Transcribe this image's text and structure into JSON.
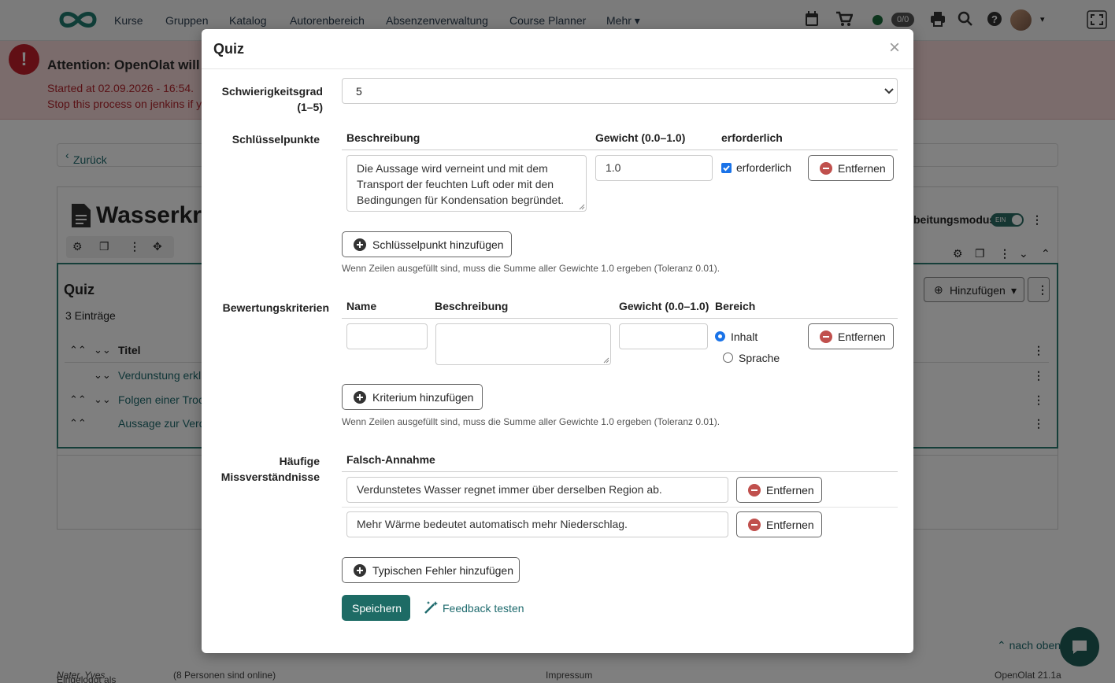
{
  "nav": {
    "items": [
      "Kurse",
      "Gruppen",
      "Katalog",
      "Autorenbereich",
      "Absenzenverwaltung",
      "Course Planner",
      "Mehr"
    ],
    "counter": "0/0"
  },
  "alert": {
    "title": "Attention: OpenOlat will s",
    "line1": "Started at 02.09.2026 - 16:54.",
    "line2": "Stop this process on jenkins if y"
  },
  "page": {
    "back": "Zurück",
    "title": "Wasserkre",
    "mode_label": "beitungsmodus",
    "toggle": "EIN",
    "quiz_title": "Quiz",
    "entries": "3 Einträge",
    "col_title": "Titel",
    "rows": [
      "Verdunstung erkl",
      "Folgen einer Troc",
      "Aussage zur Verd"
    ],
    "add_button": "Hinzufügen",
    "nach_oben": "nach oben"
  },
  "footer": {
    "logged_prefix": "Eingeloggt als",
    "user": "Nater, Yves",
    "online": "(8 Personen sind online)",
    "impressum": "Impressum",
    "version": "OpenOlat 21.1a"
  },
  "modal": {
    "title": "Quiz",
    "close": "×",
    "difficulty": {
      "label_line1": "Schwierigkeitsgrad",
      "label_line2": "(1–5)",
      "value": "5"
    },
    "keypoints": {
      "label": "Schlüsselpunkte",
      "col_desc": "Beschreibung",
      "col_weight": "Gewicht (0.0–1.0)",
      "col_required": "erforderlich",
      "row": {
        "description": "Die Aussage wird verneint und mit dem Transport der feuchten Luft oder mit den Bedingungen für Kondensation begründet.",
        "weight": "1.0",
        "required_label": "erforderlich",
        "required": true
      },
      "remove": "Entfernen",
      "add": "Schlüsselpunkt hinzufügen",
      "help": "Wenn Zeilen ausgefüllt sind, muss die Summe aller Gewichte 1.0 ergeben (Toleranz 0.01)."
    },
    "criteria": {
      "label": "Bewertungskriterien",
      "col_name": "Name",
      "col_desc": "Beschreibung",
      "col_weight": "Gewicht (0.0–1.0)",
      "col_area": "Bereich",
      "area_options": [
        "Inhalt",
        "Sprache"
      ],
      "area_selected": "Inhalt",
      "remove": "Entfernen",
      "add": "Kriterium hinzufügen",
      "help": "Wenn Zeilen ausgefüllt sind, muss die Summe aller Gewichte 1.0 ergeben (Toleranz 0.01)."
    },
    "misconceptions": {
      "label_line1": "Häufige",
      "label_line2": "Missverständnisse",
      "col": "Falsch-Annahme",
      "rows": [
        "Verdunstetes Wasser regnet immer über derselben Region ab.",
        "Mehr Wärme bedeutet automatisch mehr Niederschlag."
      ],
      "remove": "Entfernen",
      "add": "Typischen Fehler hinzufügen"
    },
    "save": "Speichern",
    "feedback": "Feedback testen"
  },
  "colors": {
    "accent": "#1d6b65",
    "link": "#1f6b6e",
    "alert_bg": "#f7d9d9",
    "alert_text": "#b2242c",
    "remove_icon": "#c0504d"
  }
}
